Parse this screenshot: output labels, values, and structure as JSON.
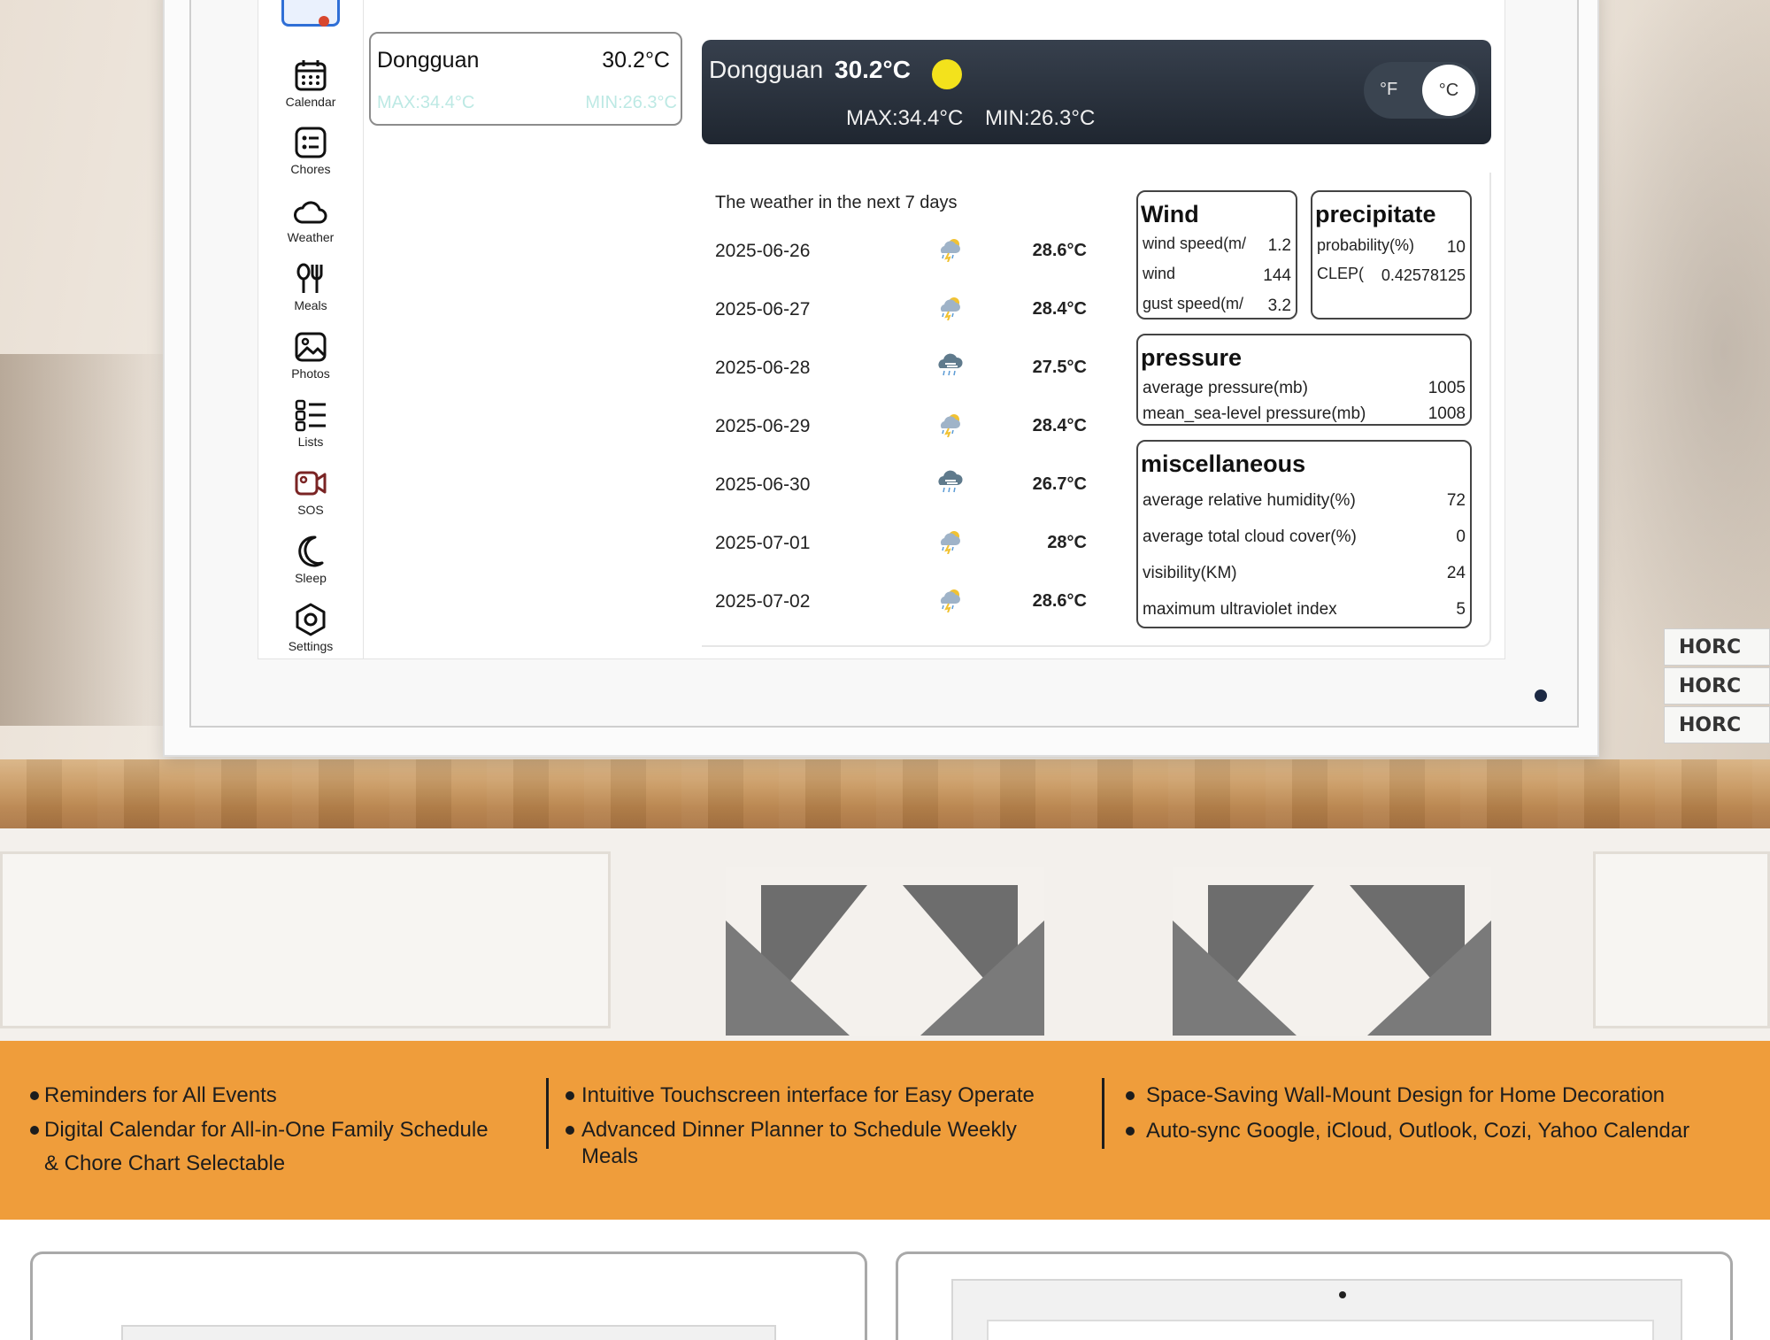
{
  "sidebar": {
    "items": [
      {
        "label": "Calendar",
        "icon": "calendar-icon"
      },
      {
        "label": "Chores",
        "icon": "checklist-icon"
      },
      {
        "label": "Weather",
        "icon": "cloud-icon"
      },
      {
        "label": "Meals",
        "icon": "utensils-icon"
      },
      {
        "label": "Photos",
        "icon": "image-icon"
      },
      {
        "label": "Lists",
        "icon": "list-icon"
      },
      {
        "label": "SOS",
        "icon": "video-camera-icon"
      },
      {
        "label": "Sleep",
        "icon": "moon-icon"
      },
      {
        "label": "Settings",
        "icon": "gear-icon"
      }
    ]
  },
  "current": {
    "city": "Dongguan",
    "temp": "30.2°C",
    "max": "MAX:34.4°C",
    "min": "MIN:26.3°C",
    "icon": "sun-icon"
  },
  "unit_toggle": {
    "fahrenheit": "°F",
    "celsius": "°C",
    "selected": "°C"
  },
  "forecast": {
    "title": "The weather in the next 7 days",
    "days": [
      {
        "date": "2025-06-26",
        "temp": "28.6°C",
        "icon": "thunder-shower-icon"
      },
      {
        "date": "2025-06-27",
        "temp": "28.4°C",
        "icon": "thunder-shower-icon"
      },
      {
        "date": "2025-06-28",
        "temp": "27.5°C",
        "icon": "rain-cloud-icon"
      },
      {
        "date": "2025-06-29",
        "temp": "28.4°C",
        "icon": "thunder-shower-icon"
      },
      {
        "date": "2025-06-30",
        "temp": "26.7°C",
        "icon": "rain-cloud-icon"
      },
      {
        "date": "2025-07-01",
        "temp": "28°C",
        "icon": "thunder-shower-icon"
      },
      {
        "date": "2025-07-02",
        "temp": "28.6°C",
        "icon": "thunder-shower-icon"
      }
    ]
  },
  "wind": {
    "title": "Wind",
    "rows": [
      {
        "label": "wind speed(m/",
        "value": "1.2"
      },
      {
        "label": "wind",
        "value": "144"
      },
      {
        "label": "gust speed(m/",
        "value": "3.2"
      }
    ]
  },
  "precipitate": {
    "title": "precipitate",
    "rows": [
      {
        "label": "probability(%)",
        "value": "10"
      },
      {
        "label": "CLEP(",
        "value": "0.42578125"
      }
    ]
  },
  "pressure": {
    "title": "pressure",
    "rows": [
      {
        "label": "average pressure(mb)",
        "value": "1005"
      },
      {
        "label": "mean_sea-level pressure(mb)",
        "value": "1008"
      }
    ]
  },
  "misc": {
    "title": "miscellaneous",
    "rows": [
      {
        "label": "average relative humidity(%)",
        "value": "72"
      },
      {
        "label": "average total cloud cover(%)",
        "value": "0"
      },
      {
        "label": "visibility(KM)",
        "value": "24"
      },
      {
        "label": "maximum ultraviolet index",
        "value": "5"
      }
    ]
  },
  "features": {
    "col1": [
      "Reminders for All Events",
      "Digital Calendar for All-in-One Family Schedule",
      "& Chore Chart Selectable"
    ],
    "col2": [
      "Intuitive Touchscreen interface for Easy Operate",
      "Advanced Dinner Planner to Schedule Weekly",
      "Meals"
    ],
    "col3": [
      "Space-Saving Wall-Mount Design for Home Decoration",
      "Auto-sync Google, iCloud, Outlook, Cozi, Yahoo Calendar"
    ]
  },
  "books": {
    "spines": [
      "HORC",
      "HORC",
      "HORC"
    ]
  },
  "colors": {
    "band": "#ef9d3b",
    "hero_bg": "#1f2630",
    "sun": "#f3e21c",
    "accent": "#2f6fd6"
  }
}
